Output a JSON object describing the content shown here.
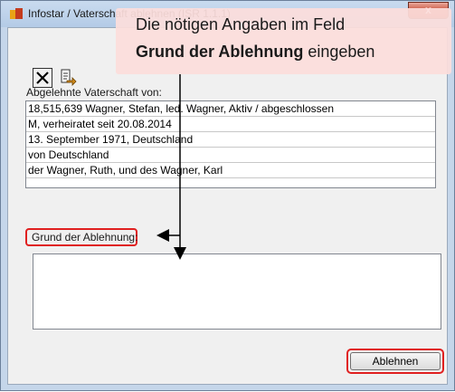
{
  "window": {
    "title": "Infostar / Vaterschaft ablehnen (ISR 1.1.1)",
    "close_glyph": "x"
  },
  "toolbar": {
    "close_icon": "close-x-icon",
    "export_icon": "export-icon"
  },
  "details": {
    "label": "Abgelehnte Vaterschaft von:",
    "lines": [
      "18,515,639  Wagner, Stefan, led. Wagner, Aktiv / abgeschlossen",
      "M, verheiratet seit 20.08.2014",
      "13. September 1971, Deutschland",
      "von Deutschland",
      "der Wagner, Ruth, und des Wagner, Karl"
    ]
  },
  "reason": {
    "label": "Grund der Ablehnung:",
    "value": ""
  },
  "actions": {
    "submit_label": "Ablehnen"
  },
  "callout": {
    "line1": "Die nötigen Angaben im Feld",
    "line2_bold": "Grund der Ablehnung",
    "line2_rest": " eingeben"
  },
  "colors": {
    "highlight": "#e02020",
    "callout_bg": "#fcdedc",
    "window_frame": "#c5d6ea"
  }
}
